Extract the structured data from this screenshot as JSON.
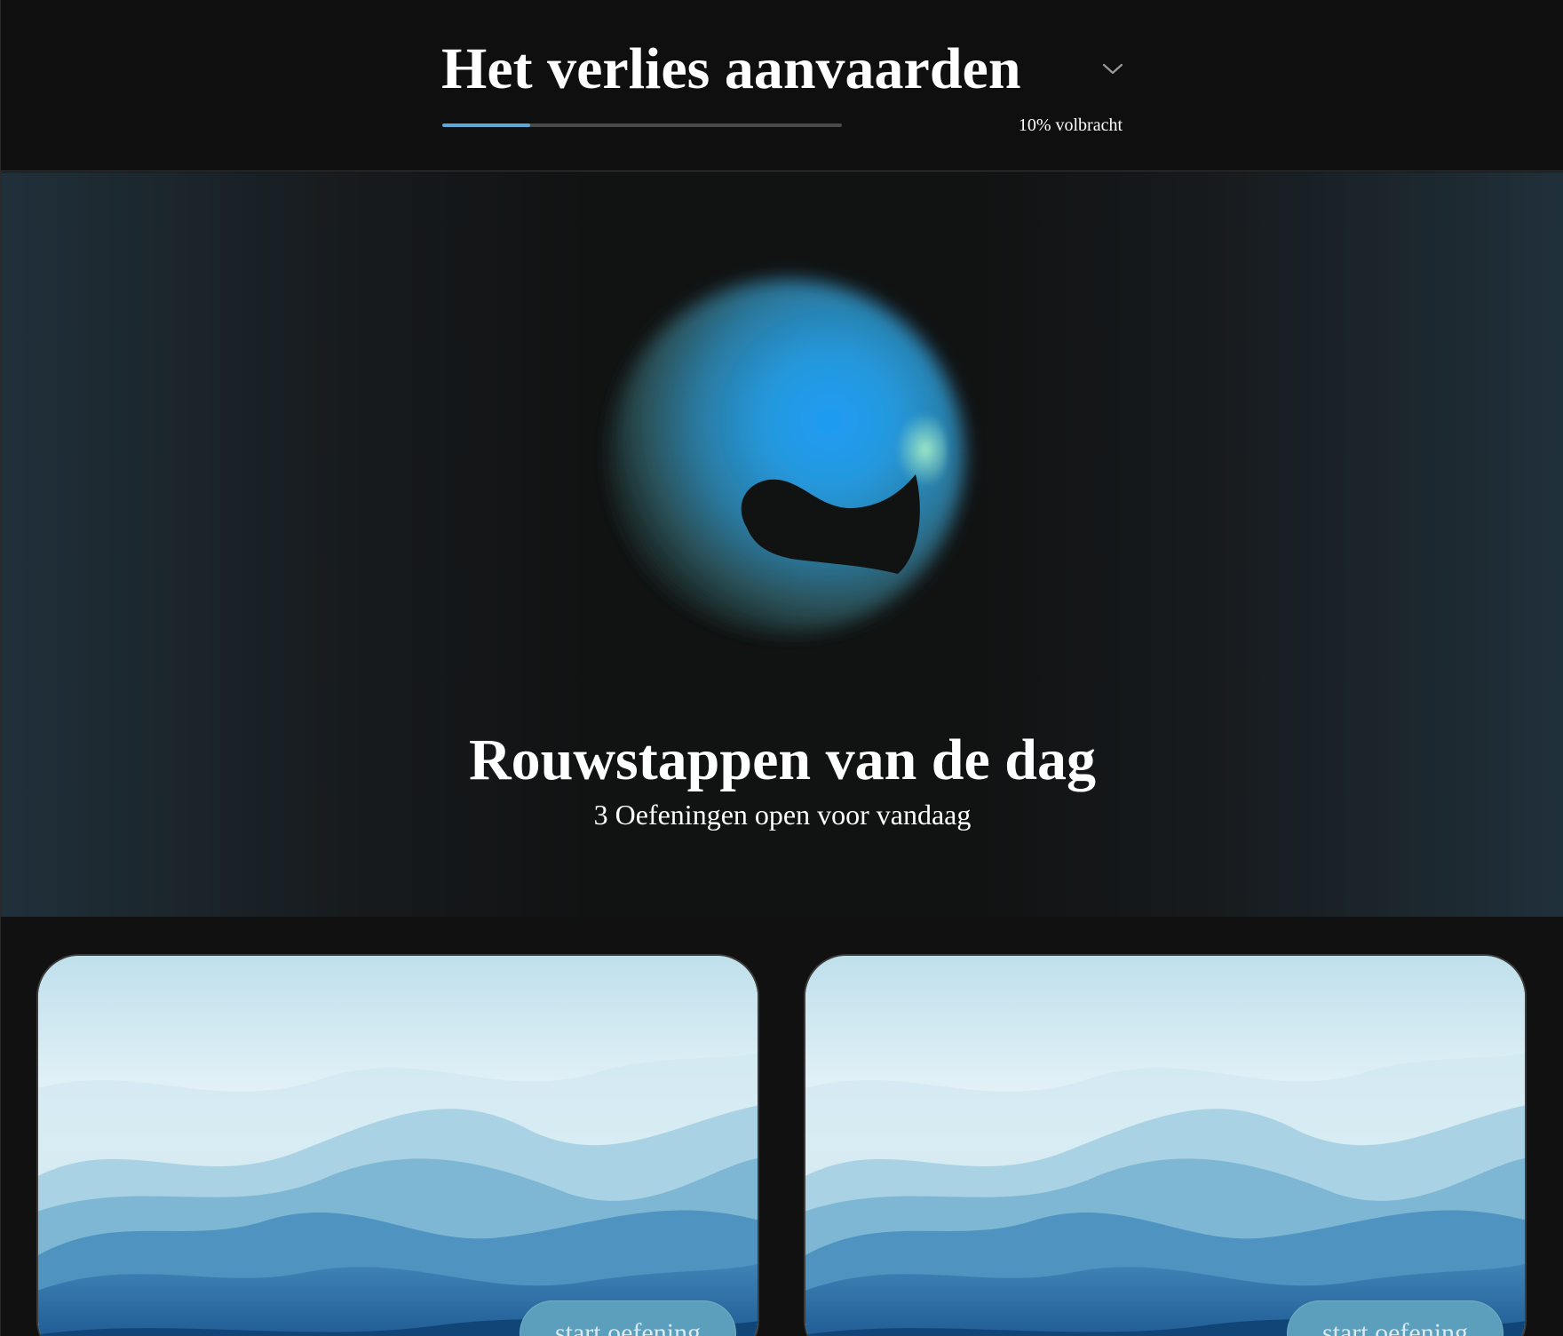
{
  "header": {
    "title": "Het verlies aanvaarden",
    "progress_fraction": 0.1,
    "progress_label": "10% volbracht",
    "chevron_icon": "chevron-down-icon"
  },
  "hero": {
    "title": "Rouwstappen van de dag",
    "subtitle": "3 Oefeningen open voor vandaag",
    "orb_colors": [
      "#1e9cf5",
      "#7fe8b8",
      "#2b6e8f"
    ]
  },
  "cards": [
    {
      "button_label": "start oefening"
    },
    {
      "button_label": "start oefening"
    }
  ],
  "colors": {
    "background": "#111111",
    "accent": "#5aa9d6",
    "button": "#5b9fbc"
  }
}
